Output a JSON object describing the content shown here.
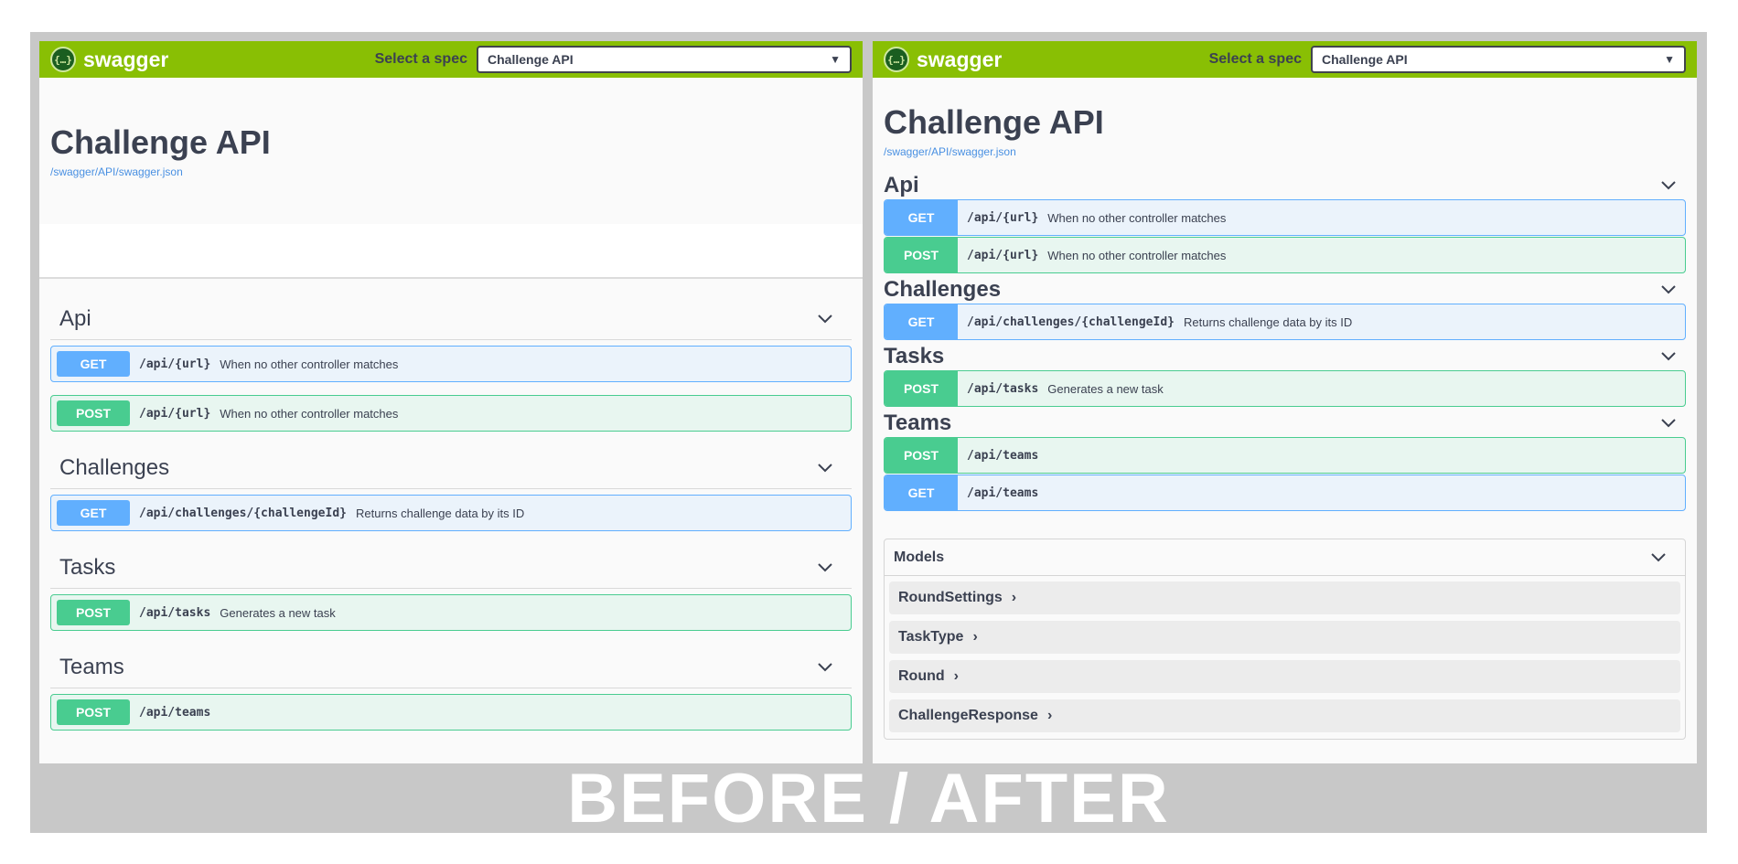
{
  "brand": "swagger",
  "spec_label": "Select a spec",
  "spec_value": "Challenge API",
  "api_title": "Challenge API",
  "api_url": "/swagger/API/swagger.json",
  "banner": "BEFORE / AFTER",
  "colors": {
    "topbar": "#89bf04",
    "get": "#61affe",
    "post": "#49cc90"
  },
  "before": {
    "tags": [
      {
        "name": "Api",
        "ops": [
          {
            "method": "GET",
            "path": "/api/{url}",
            "summary": "When no other controller matches"
          },
          {
            "method": "POST",
            "path": "/api/{url}",
            "summary": "When no other controller matches"
          }
        ]
      },
      {
        "name": "Challenges",
        "ops": [
          {
            "method": "GET",
            "path": "/api/challenges/{challengeId}",
            "summary": "Returns challenge data by its ID"
          }
        ]
      },
      {
        "name": "Tasks",
        "ops": [
          {
            "method": "POST",
            "path": "/api/tasks",
            "summary": "Generates a new task"
          }
        ]
      },
      {
        "name": "Teams",
        "ops": [
          {
            "method": "POST",
            "path": "/api/teams",
            "summary": ""
          }
        ]
      }
    ]
  },
  "after": {
    "tags": [
      {
        "name": "Api",
        "ops": [
          {
            "method": "GET",
            "path": "/api/{url}",
            "summary": "When no other controller matches"
          },
          {
            "method": "POST",
            "path": "/api/{url}",
            "summary": "When no other controller matches"
          }
        ]
      },
      {
        "name": "Challenges",
        "ops": [
          {
            "method": "GET",
            "path": "/api/challenges/{challengeId}",
            "summary": "Returns challenge data by its ID"
          }
        ]
      },
      {
        "name": "Tasks",
        "ops": [
          {
            "method": "POST",
            "path": "/api/tasks",
            "summary": "Generates a new task"
          }
        ]
      },
      {
        "name": "Teams",
        "ops": [
          {
            "method": "POST",
            "path": "/api/teams",
            "summary": ""
          },
          {
            "method": "GET",
            "path": "/api/teams",
            "summary": ""
          }
        ]
      }
    ],
    "models_title": "Models",
    "models": [
      "RoundSettings",
      "TaskType",
      "Round",
      "ChallengeResponse"
    ]
  }
}
